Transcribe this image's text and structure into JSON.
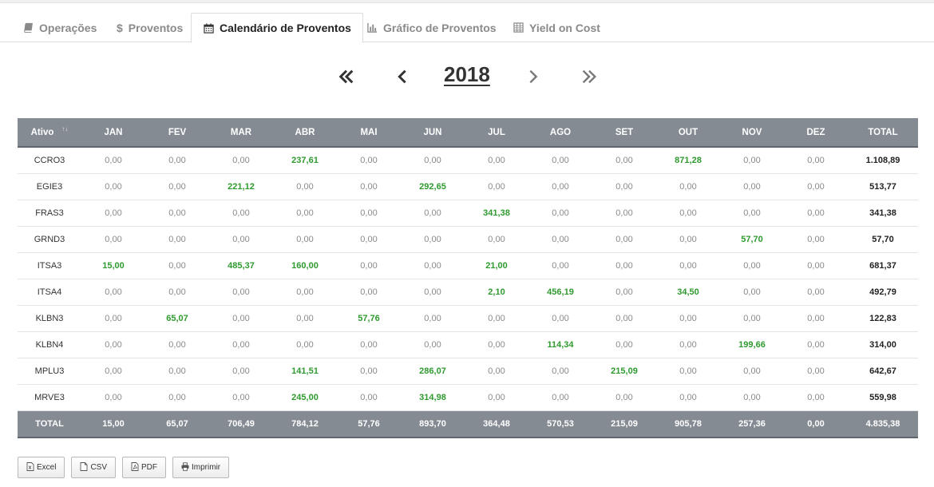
{
  "tabs": [
    {
      "label": "Operações",
      "icon": "book-icon"
    },
    {
      "label": "Proventos",
      "icon": "dollar-icon"
    },
    {
      "label": "Calendário de Proventos",
      "icon": "calendar-icon",
      "active": true
    },
    {
      "label": "Gráfico de Proventos",
      "icon": "bar-chart-icon"
    },
    {
      "label": "Yield on Cost",
      "icon": "table-icon"
    }
  ],
  "pager": {
    "year": "2018",
    "first_icon": "double-chevron-left-icon",
    "prev_icon": "chevron-left-icon",
    "next_icon": "chevron-right-icon",
    "last_icon": "double-chevron-right-icon"
  },
  "table": {
    "headers": [
      "Ativo",
      "JAN",
      "FEV",
      "MAR",
      "ABR",
      "MAI",
      "JUN",
      "JUL",
      "AGO",
      "SET",
      "OUT",
      "NOV",
      "DEZ",
      "TOTAL"
    ],
    "sort_icon": "sort-icon",
    "rows": [
      {
        "ativo": "CCRO3",
        "values": [
          "0,00",
          "0,00",
          "0,00",
          "237,61",
          "0,00",
          "0,00",
          "0,00",
          "0,00",
          "0,00",
          "871,28",
          "0,00",
          "0,00"
        ],
        "total": "1.108,89"
      },
      {
        "ativo": "EGIE3",
        "values": [
          "0,00",
          "0,00",
          "221,12",
          "0,00",
          "0,00",
          "292,65",
          "0,00",
          "0,00",
          "0,00",
          "0,00",
          "0,00",
          "0,00"
        ],
        "total": "513,77"
      },
      {
        "ativo": "FRAS3",
        "values": [
          "0,00",
          "0,00",
          "0,00",
          "0,00",
          "0,00",
          "0,00",
          "341,38",
          "0,00",
          "0,00",
          "0,00",
          "0,00",
          "0,00"
        ],
        "total": "341,38"
      },
      {
        "ativo": "GRND3",
        "values": [
          "0,00",
          "0,00",
          "0,00",
          "0,00",
          "0,00",
          "0,00",
          "0,00",
          "0,00",
          "0,00",
          "0,00",
          "57,70",
          "0,00"
        ],
        "total": "57,70"
      },
      {
        "ativo": "ITSA3",
        "values": [
          "15,00",
          "0,00",
          "485,37",
          "160,00",
          "0,00",
          "0,00",
          "21,00",
          "0,00",
          "0,00",
          "0,00",
          "0,00",
          "0,00"
        ],
        "total": "681,37"
      },
      {
        "ativo": "ITSA4",
        "values": [
          "0,00",
          "0,00",
          "0,00",
          "0,00",
          "0,00",
          "0,00",
          "2,10",
          "456,19",
          "0,00",
          "34,50",
          "0,00",
          "0,00"
        ],
        "total": "492,79"
      },
      {
        "ativo": "KLBN3",
        "values": [
          "0,00",
          "65,07",
          "0,00",
          "0,00",
          "57,76",
          "0,00",
          "0,00",
          "0,00",
          "0,00",
          "0,00",
          "0,00",
          "0,00"
        ],
        "total": "122,83"
      },
      {
        "ativo": "KLBN4",
        "values": [
          "0,00",
          "0,00",
          "0,00",
          "0,00",
          "0,00",
          "0,00",
          "0,00",
          "114,34",
          "0,00",
          "0,00",
          "199,66",
          "0,00"
        ],
        "total": "314,00"
      },
      {
        "ativo": "MPLU3",
        "values": [
          "0,00",
          "0,00",
          "0,00",
          "141,51",
          "0,00",
          "286,07",
          "0,00",
          "0,00",
          "215,09",
          "0,00",
          "0,00",
          "0,00"
        ],
        "total": "642,67"
      },
      {
        "ativo": "MRVE3",
        "values": [
          "0,00",
          "0,00",
          "0,00",
          "245,00",
          "0,00",
          "314,98",
          "0,00",
          "0,00",
          "0,00",
          "0,00",
          "0,00",
          "0,00"
        ],
        "total": "559,98"
      }
    ],
    "footer": {
      "label": "TOTAL",
      "values": [
        "15,00",
        "65,07",
        "706,49",
        "784,12",
        "57,76",
        "893,70",
        "364,48",
        "570,53",
        "215,09",
        "905,78",
        "257,36",
        "0,00"
      ],
      "total": "4.835,38"
    }
  },
  "exports": [
    {
      "label": "Excel",
      "icon": "excel-file-icon"
    },
    {
      "label": "CSV",
      "icon": "file-icon"
    },
    {
      "label": "PDF",
      "icon": "pdf-file-icon"
    },
    {
      "label": "Imprimir",
      "icon": "printer-icon"
    }
  ],
  "colors": {
    "header_bg": "#848b93",
    "positive_value": "#2f9a2f",
    "zero_value": "#8a8a8a"
  }
}
